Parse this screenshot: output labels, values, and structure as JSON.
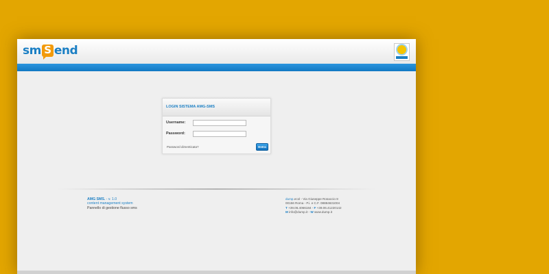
{
  "header": {
    "logo": {
      "part1": "sm",
      "part2": "S",
      "part3": "end"
    },
    "badge_icon": "sun-logo-icon"
  },
  "login": {
    "title": "LOGIN SISTEMA AMG-SMS",
    "username_label": "Username:",
    "username_value": "",
    "password_label": "Password:",
    "password_value": "",
    "forgot_link": "Password dimenticata?",
    "submit_label": "Entra"
  },
  "footer": {
    "app_name": "AMG SMS.",
    "version": " - v. 1.0",
    "line2": "content management system",
    "line3": "Pannello di gestione flusso sms",
    "company_brand": "dump",
    "company_rest": ".ecol - Via Giuseppe Rosaccio 8",
    "address": "00156 Roma - P.i. e C.F. 08884631004",
    "phone_label": "T",
    "phone": " +39.06.4066184 - ",
    "fax_label": "F",
    "fax": " +39.06.41220142",
    "mail_label": "M",
    "mail": " info@dump.it - ",
    "web_label": "W",
    "web": " www.dump.it"
  },
  "colors": {
    "background": "#e3a601",
    "accent": "#1b7fc4",
    "logo_orange": "#f29a0b"
  }
}
